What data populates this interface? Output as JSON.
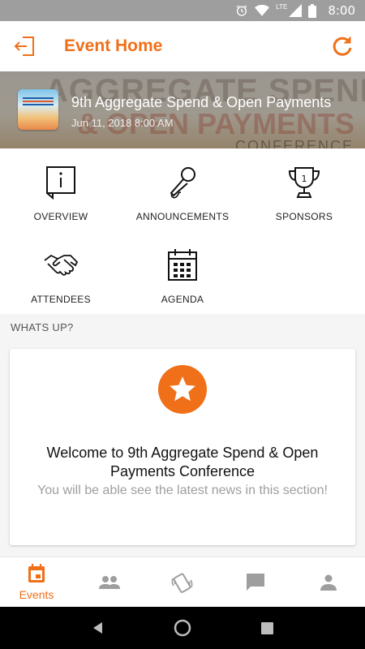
{
  "status_bar": {
    "time": "8:00",
    "network": "LTE"
  },
  "app_bar": {
    "title": "Event Home"
  },
  "event": {
    "title": "9th Aggregate Spend & Open Payments",
    "date": "Jun 11, 2018 8:00 AM",
    "banner_text_1": "AGGREGATE SPEND",
    "banner_text_2": "& OPEN PAYMENTS",
    "banner_text_3": "CONFERENCE"
  },
  "menu": {
    "items": [
      {
        "label": "OVERVIEW",
        "icon": "info-book-icon"
      },
      {
        "label": "ANNOUNCEMENTS",
        "icon": "microphone-icon"
      },
      {
        "label": "SPONSORS",
        "icon": "trophy-icon"
      },
      {
        "label": "ATTENDEES",
        "icon": "handshake-icon"
      },
      {
        "label": "AGENDA",
        "icon": "calendar-icon"
      }
    ]
  },
  "whats_up": {
    "header": "WHATS UP?",
    "welcome": "Welcome to 9th Aggregate Spend & Open Payments Conference",
    "subtitle": "You will be able see the latest news in this section!"
  },
  "bottom_nav": {
    "items": [
      {
        "label": "Events",
        "icon": "calendar-event-icon",
        "active": true
      },
      {
        "label": "",
        "icon": "people-icon",
        "active": false
      },
      {
        "label": "",
        "icon": "phone-shake-icon",
        "active": false
      },
      {
        "label": "",
        "icon": "chat-icon",
        "active": false
      },
      {
        "label": "",
        "icon": "person-icon",
        "active": false
      }
    ]
  },
  "colors": {
    "accent": "#f07019",
    "inactive_icon": "#9e9e9e",
    "status_bar": "#9e9e9e"
  }
}
